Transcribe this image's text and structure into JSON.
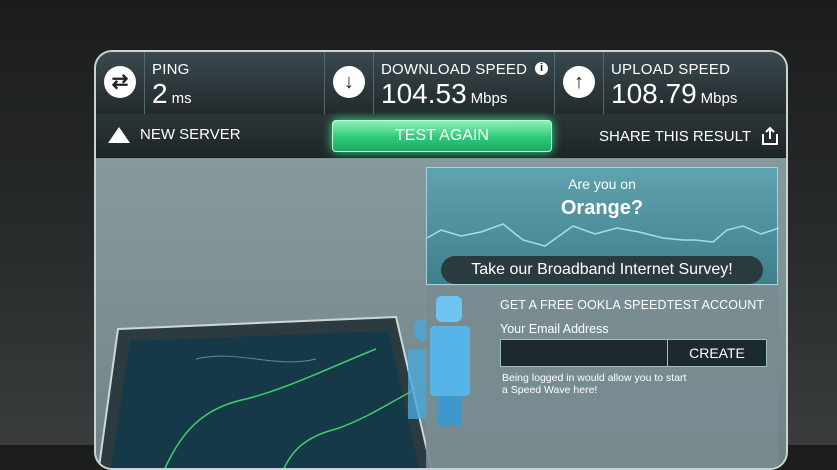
{
  "stats": {
    "ping": {
      "label": "PING",
      "value": "2",
      "unit": "ms",
      "icon": "swap-arrows-icon"
    },
    "download": {
      "label": "DOWNLOAD SPEED",
      "value": "104.53",
      "unit": "Mbps",
      "icon": "arrow-down-icon",
      "info": "i"
    },
    "upload": {
      "label": "UPLOAD SPEED",
      "value": "108.79",
      "unit": "Mbps",
      "icon": "arrow-up-icon"
    }
  },
  "actions": {
    "new_server": "NEW SERVER",
    "test_again": "TEST AGAIN",
    "share": "SHARE THIS RESULT"
  },
  "promo": {
    "question": "Are you on",
    "isp": "Orange?",
    "survey_button": "Take our Broadband Internet Survey!"
  },
  "signup": {
    "title": "GET A FREE OOKLA SPEEDTEST ACCOUNT",
    "email_label": "Your Email Address",
    "email_value": "",
    "create_button": "CREATE",
    "note": "Being logged in would allow you to start a Speed Wave here!"
  },
  "colors": {
    "accent_green": "#2ec978",
    "panel": "#22292c",
    "promo": "#4f93a0"
  }
}
